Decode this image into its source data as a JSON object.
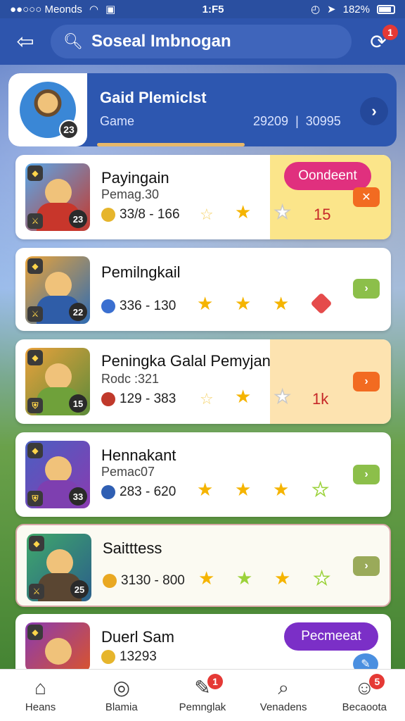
{
  "status_bar": {
    "left": "●●○○○ Meonds",
    "time": "1:F5",
    "battery": "182%"
  },
  "header": {
    "search_text": "Sosеal Imbnogan",
    "notif_badge": "1"
  },
  "profile": {
    "title": "Gaid Plemiclst",
    "subtitle": "Game",
    "stat1": "29209",
    "separator": "|",
    "stat2": "30995",
    "avatar_level": "23"
  },
  "items": [
    {
      "title": "Payingain",
      "subtitle": "Pemag.30",
      "stat": "33/8 - 166",
      "level": "23",
      "pill": "Oondeent",
      "value": "15"
    },
    {
      "title": "Pemilngkail",
      "subtitle": "",
      "stat": "336 - 130",
      "level": "22"
    },
    {
      "title": "Peningka Galal Pemyjan",
      "subtitle": "Rodc :321",
      "stat": "129 - 383",
      "level": "15",
      "value": "1k"
    },
    {
      "title": "Hennakant",
      "subtitle": "Pemac07",
      "stat": "283 - 620",
      "level": "33"
    },
    {
      "title": "Saitttess",
      "subtitle": "",
      "stat": "3130 - 800",
      "level": "25"
    },
    {
      "title": "Duerl Sam",
      "subtitle": "",
      "stat": "13293",
      "pill": "Pecmeeat"
    }
  ],
  "nav": [
    {
      "label": "Heans",
      "icon": "home-icon",
      "glyph": "⌂"
    },
    {
      "label": "Blamia",
      "icon": "medal-icon",
      "glyph": "◎"
    },
    {
      "label": "Pemnglak",
      "icon": "edit-icon",
      "glyph": "✎",
      "badge": "1"
    },
    {
      "label": "Venadens",
      "icon": "search-icon",
      "glyph": "⌕"
    },
    {
      "label": "Becaoota",
      "icon": "user-icon",
      "glyph": "☺",
      "badge": "5"
    }
  ],
  "colors": {
    "header": "#2e55ad",
    "pill_pink": "#e0307e",
    "pill_purple": "#7b2fc7",
    "arrow_orange": "#f26b21",
    "arrow_green": "#8cbf4a",
    "highlight_yellow": "#fbe58a",
    "highlight_peach": "#fde3b0"
  }
}
